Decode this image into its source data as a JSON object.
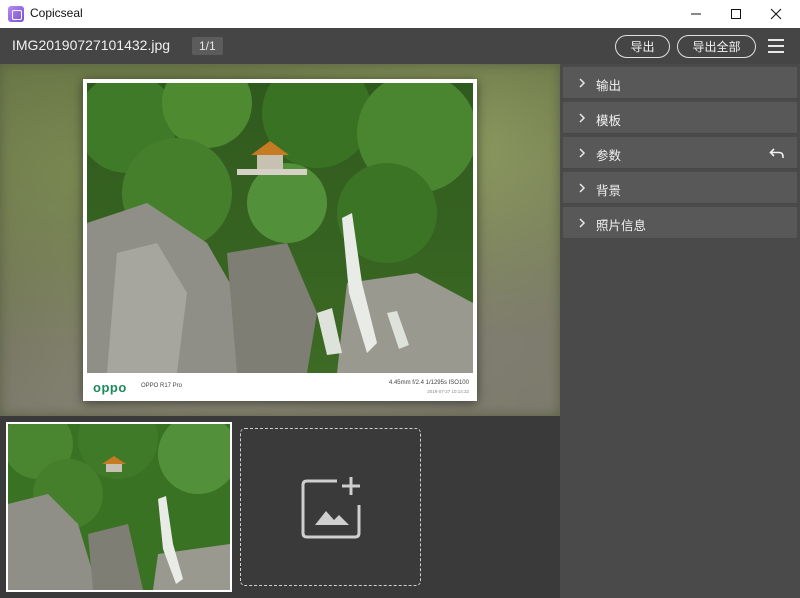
{
  "window": {
    "title": "Copicseal",
    "icons": [
      "app-icon",
      "minimize-icon",
      "maximize-icon",
      "close-icon"
    ]
  },
  "header": {
    "filename": "IMG20190727101432.jpg",
    "counter": "1/1",
    "export_label": "导出",
    "export_all_label": "导出全部",
    "menu_icon": "hamburger-menu-icon"
  },
  "preview": {
    "brand": "oppo",
    "model": "OPPO R17 Pro",
    "exif": "4.45mm  f/2.4  1/1295s  ISO100",
    "date": "2019-07-27 10:14:32"
  },
  "sidebar": {
    "items": [
      {
        "label": "输出"
      },
      {
        "label": "模板"
      },
      {
        "label": "参数"
      },
      {
        "label": "背景"
      },
      {
        "label": "照片信息"
      }
    ]
  },
  "colors": {
    "titlebar": "#ffffff",
    "header": "#454545",
    "panel": "#4a4a4a",
    "panel_item": "#585858",
    "brand_green": "#1e8a5a"
  }
}
